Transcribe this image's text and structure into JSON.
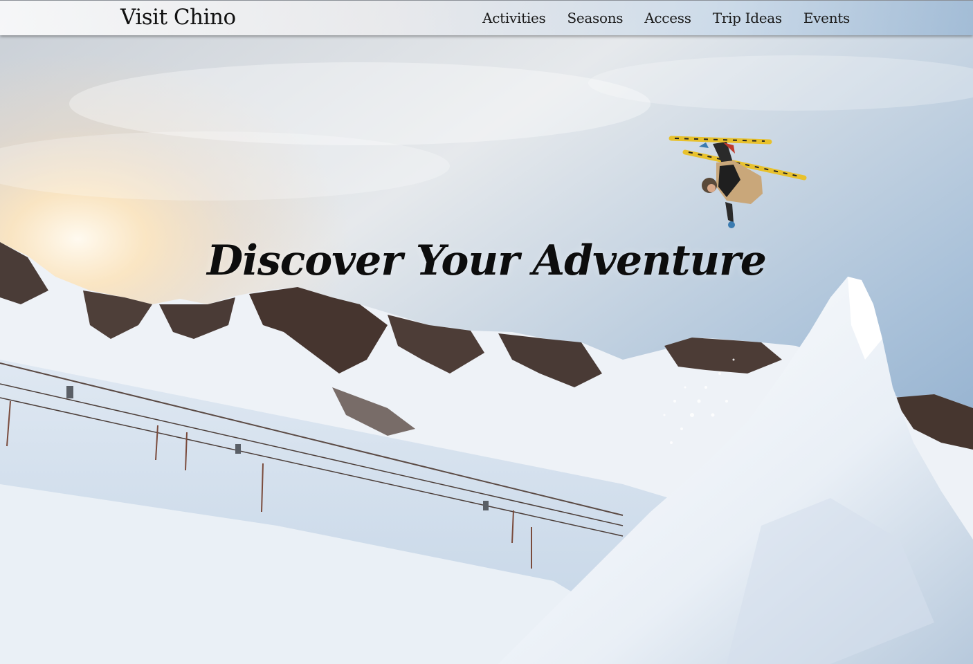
{
  "brand": {
    "name": "Visit Chino"
  },
  "nav": {
    "items": [
      {
        "label": "Activities"
      },
      {
        "label": "Seasons"
      },
      {
        "label": "Access"
      },
      {
        "label": "Trip Ideas"
      },
      {
        "label": "Events"
      }
    ]
  },
  "hero": {
    "headline": "Discover Your Adventure",
    "image_subject": "skier-mid-air-flip-over-snow-jump-with-mountains"
  },
  "colors": {
    "sky_top": "#7fa3c9",
    "sky_mid": "#dfe6ee",
    "sun_glow": "#ffe2b0",
    "snow": "#f3f6fa",
    "rock": "#4a3a35",
    "ski_yellow": "#e8c12c"
  }
}
